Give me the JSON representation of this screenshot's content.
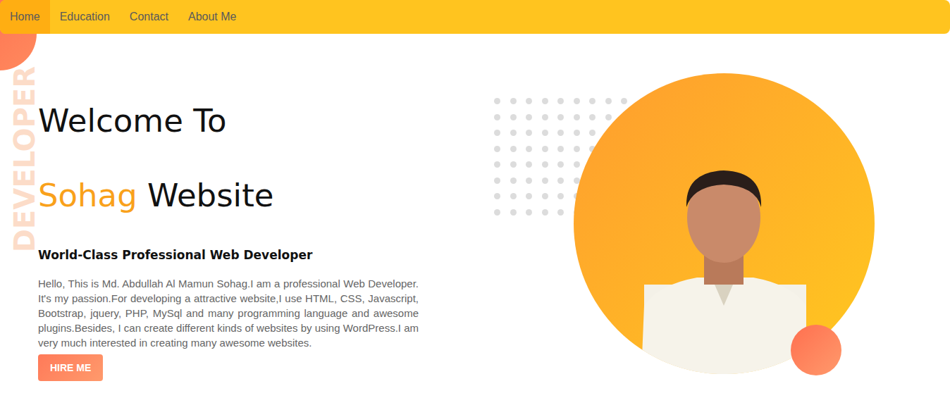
{
  "nav": [
    {
      "label": "Home",
      "selected": true
    },
    {
      "label": "Education",
      "selected": false
    },
    {
      "label": "Contact",
      "selected": false
    },
    {
      "label": "About Me",
      "selected": false
    }
  ],
  "watermark": "DEVELOPER",
  "hero": {
    "greeting": "Welcome To",
    "name": "Sohag",
    "title_rest": "Website",
    "subtitle": "World-Class Professional Web Developer",
    "paragraph": "Hello, This is Md. Abdullah Al Mamun Sohag.I am a professional Web Developer. It's my passion.For developing a attractive website,I use HTML, CSS, Javascript, Bootstrap, jquery, PHP, MySql and many programming language and awesome plugins.Besides, I can create different kinds of websites by using WordPress.I am very much interested in creating many awesome websites.",
    "button": "HIRE ME"
  }
}
